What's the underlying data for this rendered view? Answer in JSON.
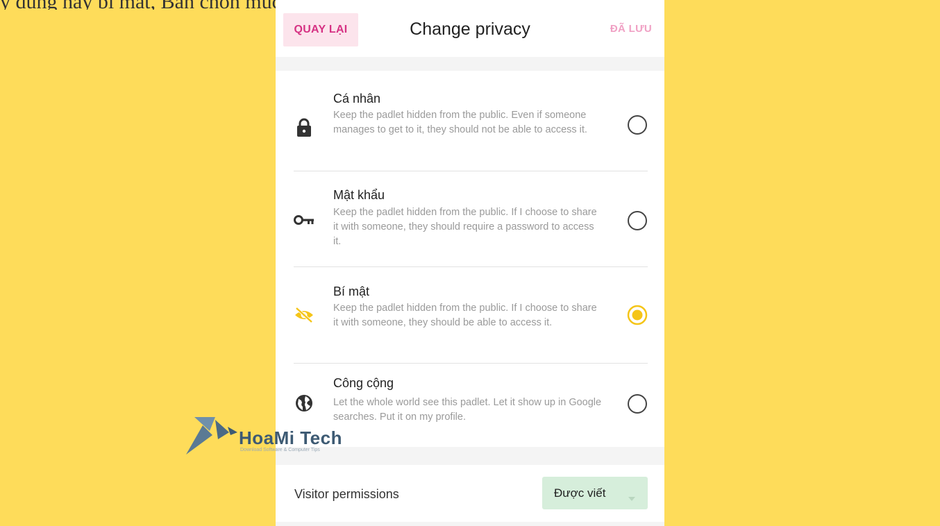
{
  "caption": "y dụng hay bí mật, Bạn chọn mục nào ...g...",
  "header": {
    "back_label": "QUAY LẠI",
    "title": "Change privacy",
    "save_label": "ĐÃ LƯU"
  },
  "options": [
    {
      "title": "Cá nhân",
      "description": "Keep the padlet hidden from the public. Even if someone manages to get to it, they should not be able to access it.",
      "icon": "lock-icon",
      "selected": false
    },
    {
      "title": "Mật khẩu",
      "description": "Keep the padlet hidden from the public. If I choose to share it with someone, they should require a password to access it.",
      "icon": "key-icon",
      "selected": false
    },
    {
      "title": "Bí mật",
      "description": "Keep the padlet hidden from the public. If I choose to share it with someone, they should be able to access it.",
      "icon": "eye-off-icon",
      "selected": true
    },
    {
      "title": "Công cộng",
      "description": "Let the whole world see this padlet. Let it show up in Google searches. Put it on my profile.",
      "icon": "globe-icon",
      "selected": false
    }
  ],
  "visitor": {
    "label": "Visitor permissions",
    "value": "Được viết"
  },
  "watermark": {
    "brand": "HoaMi Tech",
    "tagline": "Download Software & Computer Tips"
  },
  "colors": {
    "background": "#fedc5a",
    "accent_selected": "#f5c518",
    "back_button": "#d63384",
    "permission_button": "#d6eedb"
  }
}
